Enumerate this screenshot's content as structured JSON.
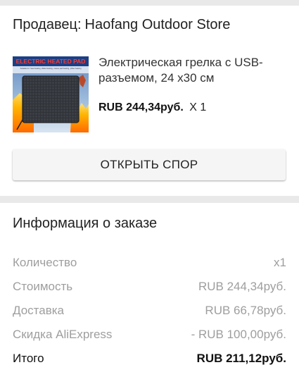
{
  "seller": {
    "label": "Продавец:",
    "name": "Haofang Outdoor Store"
  },
  "product": {
    "image_banner": "ELECTRIC HEATED PAD",
    "image_caption": "Suitable for: Seat heating, Waist heating, mouse pad heating, pillow heating",
    "title": "Электрическая грелка с USB-разъемом, 24 x30 см",
    "price": "RUB 244,34руб.",
    "quantity": "X 1"
  },
  "actions": {
    "open_dispute_label": "ОТКРЫТЬ СПОР"
  },
  "order_info": {
    "heading": "Информация о заказе",
    "rows": [
      {
        "label": "Количество",
        "value": "x1"
      },
      {
        "label": "Стоимость",
        "value": "RUB 244,34руб."
      },
      {
        "label": "Доставка",
        "value": "RUB 66,78руб."
      },
      {
        "label": "Скидка AliExpress",
        "value": "- RUB 100,00руб."
      }
    ],
    "total": {
      "label": "Итого",
      "value": "RUB 211,12руб."
    }
  },
  "colors": {
    "background": "#e9e9e9",
    "card": "#ffffff",
    "muted_text": "#9e9e9e",
    "button_bg": "#f5f5f5"
  }
}
